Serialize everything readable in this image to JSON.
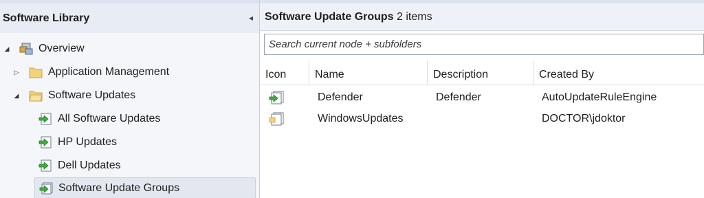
{
  "nav": {
    "title": "Software Library",
    "collapse_glyph": "◂",
    "tree": [
      {
        "label": "Overview",
        "expander": "◢",
        "icon": "overview-icon"
      },
      {
        "label": "Application Management",
        "expander": "▷",
        "icon": "folder-icon"
      },
      {
        "label": "Software Updates",
        "expander": "◢",
        "icon": "folder-open-icon"
      },
      {
        "label": "All Software Updates",
        "icon": "software-updates-icon"
      },
      {
        "label": "HP Updates",
        "icon": "software-updates-icon"
      },
      {
        "label": "Dell Updates",
        "icon": "software-updates-icon"
      },
      {
        "label": "Software Update Groups",
        "icon": "update-groups-icon",
        "selected": true
      }
    ]
  },
  "content": {
    "title": "Software Update Groups",
    "count_text": "2 items",
    "search_placeholder": "Search current node + subfolders",
    "columns": [
      "Icon",
      "Name",
      "Description",
      "Created By"
    ],
    "sorted_column": "Name",
    "rows": [
      {
        "icon": "update-group-icon",
        "name": "Defender",
        "description": "Defender",
        "created_by": "AutoUpdateRuleEngine"
      },
      {
        "icon": "update-group-icon",
        "name": "WindowsUpdates",
        "description": "",
        "created_by": "DOCTOR\\jdoktor"
      }
    ]
  },
  "colors": {
    "nav_bg": "#f4f6fa",
    "header_bg": "#eef1f7",
    "selection_bg": "#e3e8f0",
    "folder": "#f3d27a",
    "green_arrow": "#3fae3a"
  }
}
